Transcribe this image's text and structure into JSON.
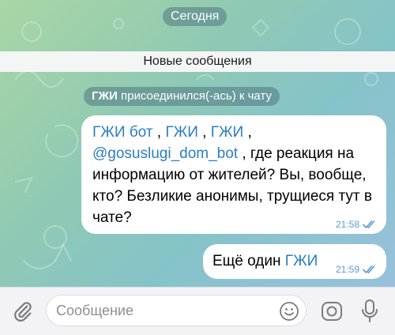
{
  "chat": {
    "date_label": "Сегодня",
    "new_messages_label": "Новые сообщения",
    "join_notice": {
      "user": "ГЖИ",
      "text": " присоединился(-ась) к чату"
    }
  },
  "messages": [
    {
      "mention1": "ГЖИ бот",
      "sep1": " , ",
      "mention2": "ГЖИ",
      "sep2": " , ",
      "mention3": "ГЖИ",
      "sep3": " ,",
      "mention4": "@gosuslugi_dom_bot",
      "text": " , где реакция на информацию от жителей? Вы, вообще, кто? Безликие анонимы, трущиеся тут в чате?",
      "time": "21:58"
    },
    {
      "text": "Ещё один ",
      "mention": "ГЖИ",
      "time": "21:59"
    }
  ],
  "composer": {
    "placeholder": "Сообщение",
    "icons": [
      "paperclip-icon",
      "emoji-icon",
      "camera-icon",
      "microphone-icon"
    ]
  },
  "colors": {
    "mention": "#2a7ec2",
    "time": "#5a9bd0",
    "bubble": "#ffffff"
  }
}
